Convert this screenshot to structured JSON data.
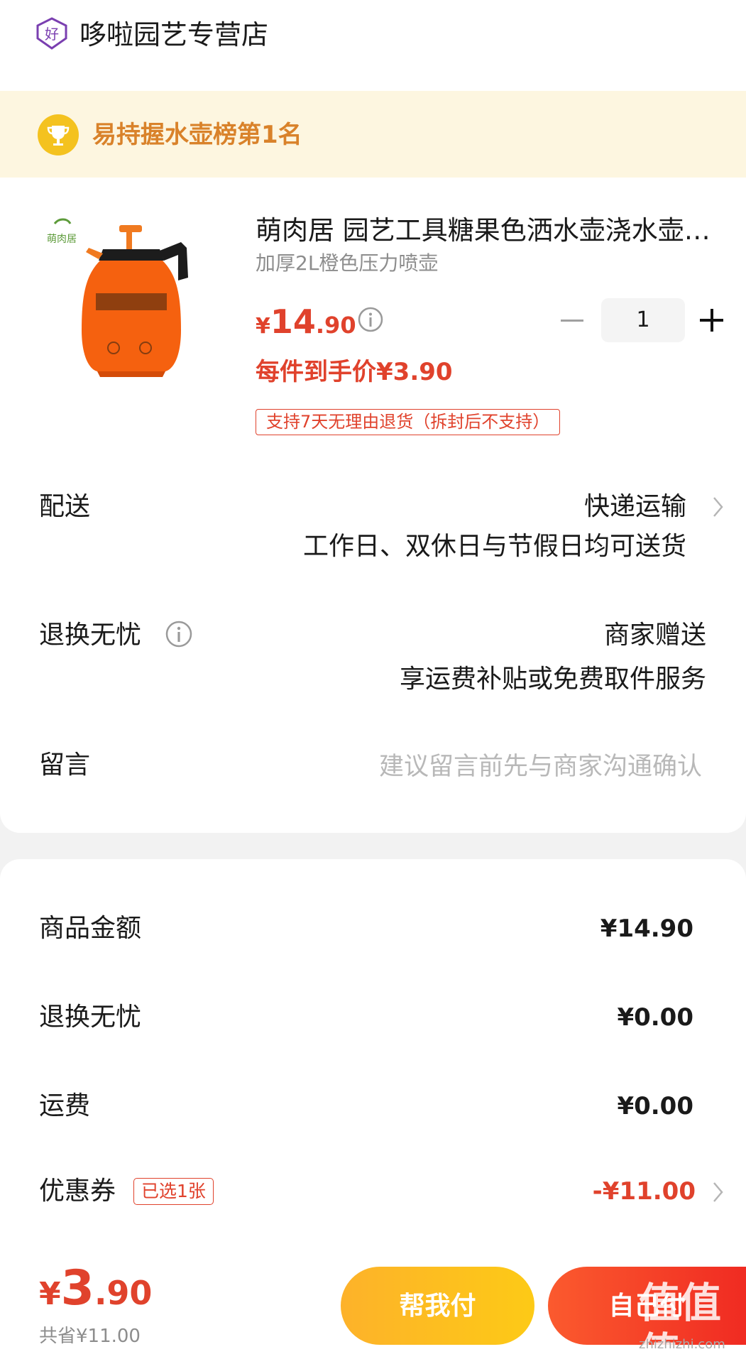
{
  "store": {
    "name": "哆啦园艺专营店",
    "icon": "hao-badge-icon",
    "icon_glyph": "好",
    "icon_color": "#7a3fb0"
  },
  "rank": {
    "text": "易持握水壶榜第1名",
    "icon": "trophy-icon",
    "color": "#d9822a",
    "banner_bg": "#fdf6e0"
  },
  "product": {
    "title": "萌肉居 园艺工具糖果色洒水壶浇水壶喷壶",
    "spec": "加厚2L橙色压力喷壶",
    "image_brand": "萌肉居",
    "price_symbol": "¥",
    "price_int": "14",
    "price_dec": ".90",
    "net_price": "每件到手价¥3.90",
    "return_tag": "支持7天无理由退货（拆封后不支持）",
    "quantity": "1"
  },
  "delivery": {
    "label": "配送",
    "method": "快递运输",
    "schedule": "工作日、双休日与节假日均可送货"
  },
  "return_service": {
    "label": "退换无忧",
    "value": "商家赠送",
    "desc": "享运费补贴或免费取件服务"
  },
  "note": {
    "label": "留言",
    "placeholder": "建议留言前先与商家沟通确认"
  },
  "summary": {
    "goods_label": "商品金额",
    "goods_value": "¥14.90",
    "return_label": "退换无忧",
    "return_value": "¥0.00",
    "shipping_label": "运费",
    "shipping_value": "¥0.00",
    "coupon_label": "优惠券",
    "coupon_badge": "已选1张",
    "coupon_value": "-¥11.00"
  },
  "bottom": {
    "total_symbol": "¥",
    "total_int": "3",
    "total_dec": ".90",
    "saved": "共省¥11.00",
    "help_pay": "帮我付",
    "self_pay": "自己付"
  },
  "watermark": {
    "text": "值值值",
    "url": "zhizhizhi.com"
  },
  "colors": {
    "accent": "#e0422c",
    "gold": "#fdb22a",
    "red_button": "#f02b22"
  }
}
